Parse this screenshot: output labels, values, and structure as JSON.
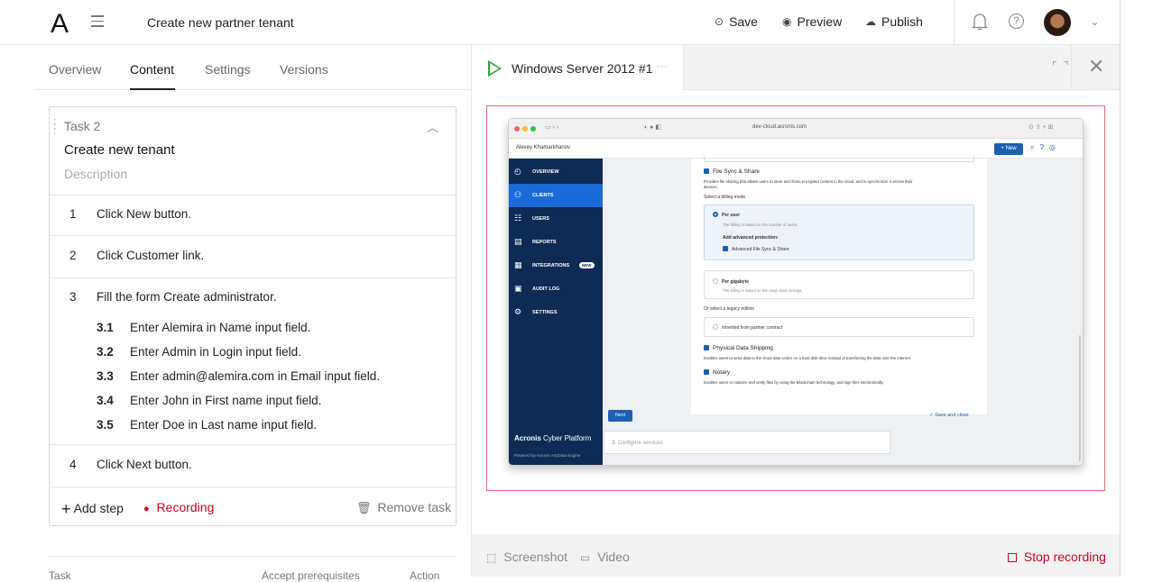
{
  "header": {
    "logo": "A",
    "page_title": "Create new partner tenant",
    "save_label": "Save",
    "preview_label": "Preview",
    "publish_label": "Publish",
    "help_glyph": "?",
    "chevron_glyph": "⌄"
  },
  "tabs": [
    {
      "label": "Overview",
      "active": false
    },
    {
      "label": "Content",
      "active": true
    },
    {
      "label": "Settings",
      "active": false
    },
    {
      "label": "Versions",
      "active": false
    }
  ],
  "task": {
    "label": "Task 2",
    "title": "Create new tenant",
    "description_placeholder": "Description",
    "steps": [
      {
        "num": "1",
        "text": "Click New button."
      },
      {
        "num": "2",
        "text": "Click Customer link."
      },
      {
        "num": "3",
        "text": "Fill the form Create administrator."
      },
      {
        "num": "4",
        "text": "Click Next button."
      }
    ],
    "substeps": [
      {
        "num": "3.1",
        "text": "Enter Alemira in Name input field."
      },
      {
        "num": "3.2",
        "text": "Enter Admin in Login input field."
      },
      {
        "num": "3.3",
        "text": "Enter admin@alemira.com in Email input field."
      },
      {
        "num": "3.4",
        "text": "Enter John in First name input field."
      },
      {
        "num": "3.5",
        "text": "Enter Doe in Last name input field."
      }
    ],
    "add_step_label": "Add step",
    "recording_label": "Recording",
    "remove_task_label": "Remove task"
  },
  "below_card": {
    "cut_text_1": "Task",
    "cut_text_2": "Accept prerequisites",
    "cut_text_3": "Action"
  },
  "right_panel": {
    "tab_label": "Windows Server 2012 #1",
    "tab_more": "···",
    "fullscreen_glyph": "⌜ ⌝",
    "close_glyph": "✕",
    "screenshot_label": "Screenshot",
    "video_label": "Video",
    "stop_recording_label": "Stop recording"
  },
  "embedded": {
    "url": "dev-cloud.acronis.com",
    "user": "Alexey Khamarkhanov",
    "new_button": "+ New",
    "nav": [
      {
        "label": "OVERVIEW",
        "icon": "gauge-icon",
        "glyph": "◴",
        "active": false
      },
      {
        "label": "CLIENTS",
        "icon": "clients-icon",
        "glyph": "⚇",
        "active": true
      },
      {
        "label": "USERS",
        "icon": "users-icon",
        "glyph": "☷",
        "active": false
      },
      {
        "label": "REPORTS",
        "icon": "reports-icon",
        "glyph": "▤",
        "active": false
      },
      {
        "label": "INTEGRATIONS",
        "icon": "integrations-icon",
        "glyph": "▦",
        "active": false
      },
      {
        "label": "AUDIT LOG",
        "icon": "audit-icon",
        "glyph": "▣",
        "active": false
      },
      {
        "label": "SETTINGS",
        "icon": "gear-icon",
        "glyph": "⚙",
        "active": false
      }
    ],
    "new_badge": "NEW",
    "brand_bold": "Acronis",
    "brand_rest": " Cyber Platform",
    "powered": "Powered by Acronis AnyData Engine",
    "file_sync": "File Sync & Share",
    "file_sync_desc": "Provides file sharing that allows users to store and share encrypted content in the cloud, and to synchronize it across their",
    "file_sync_desc2": "devices.",
    "billing_mode": "Select a billing mode",
    "per_user": "Per user",
    "per_user_desc": "The billing is based on the number of users.",
    "adv_protection": "Add advanced protection:",
    "adv_fss": "Advanced File Sync & Share",
    "per_gb": "Per gigabyte",
    "per_gb_desc": "The billing is based on the used cloud storage.",
    "legacy": "Or select a legacy edition",
    "inherited": "Inherited from partner contract",
    "pds": "Physical Data Shipping",
    "pds_desc": "Enables users to send data to the cloud data center on a hard disk drive instead of transferring the data over the Internet.",
    "notary": "Notary",
    "notary_desc": "Enables users to notarize and verify files by using the Blockchain technology, and sign files electronically.",
    "next": "Next",
    "save_close": "✓ Save and close",
    "step3": "3. Configure services"
  }
}
